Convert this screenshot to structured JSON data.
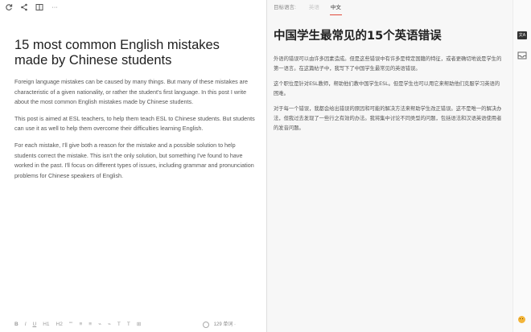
{
  "toolbar": {
    "icons": [
      "refresh-icon",
      "share-icon",
      "layout-icon",
      "more-icon"
    ],
    "more_label": "···"
  },
  "document": {
    "title": "15 most common English mistakes made by Chinese students",
    "paragraphs": [
      "Foreign language mistakes can be caused by many things. But many of these mistakes are characteristic of a given nationality, or rather the student's first language. In this post I write about the most common English mistakes made by Chinese students.",
      "This post is aimed at ESL teachers, to help them teach ESL to Chinese students. But students can use it as well to help them overcome their difficulties learning English.",
      "For each mistake, I'll give both a reason for the mistake and a possible solution to help students correct the mistake. This isn't the only solution, but something I've found to have worked in the past. I'll focus on different types of issues, including grammar and pronunciation problems for Chinese speakers of English."
    ]
  },
  "format_bar": {
    "buttons": [
      "B",
      "I",
      "U",
      "H1",
      "H2",
      "\"\"",
      "≡",
      "≡",
      "⌁",
      "⌁",
      "T",
      "T",
      "⊞"
    ],
    "word_count": "129 单词 ·"
  },
  "translation": {
    "target_label": "目标语言:",
    "languages": [
      "英语",
      "中文"
    ],
    "active_language": "中文",
    "title": "中国学生最常见的15个英语错误",
    "paragraphs": [
      "外语的错误可以由许多因素造成。但是这些错误中有许多是特定国籍的特征，或者更确切地说是学生的第一语言。在这篇帖子中，我写下了中国学生最常见的英语错误。",
      "这个职位是针对ESL教师，帮助他们教中国学生ESL。但是学生也可以用它来帮助他们克服学习英语的困难。",
      "对于每一个错误，我都会给出错误的原因和可能的解决方法来帮助学生改正错误。这不是唯一的解决办法，但我过去发现了一些行之有效的办法。我将集中讨论不同类型的问题，包括语法和汉语英语使用者的发音问题。"
    ]
  },
  "rail": {
    "translate_label": "文A",
    "icons": [
      "translate-icon",
      "inbox-icon",
      "emoji-icon"
    ]
  },
  "colors": {
    "accent": "#e04a3a",
    "rail_button": "#333333"
  }
}
